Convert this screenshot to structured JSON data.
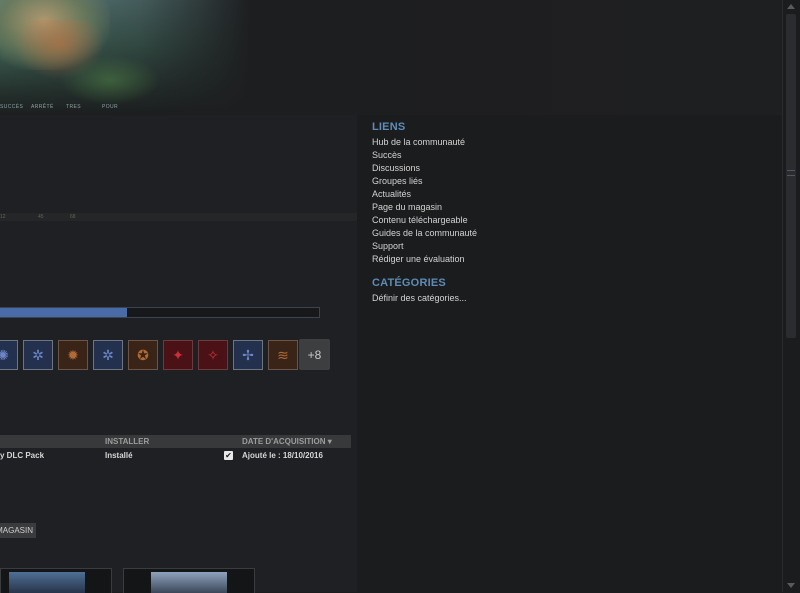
{
  "hero": {
    "tabs": [
      "SUCCÈS",
      "ARRÊTÉ",
      "TRES",
      "POUR"
    ]
  },
  "stats": [
    "12",
    "45",
    "68"
  ],
  "achievements": {
    "progress_fraction": 0.4,
    "more_label": "+8",
    "icons": [
      {
        "name": "achievement-icon-1",
        "style": "blue",
        "glyph": "✺"
      },
      {
        "name": "achievement-icon-2",
        "style": "blue",
        "glyph": "✲"
      },
      {
        "name": "achievement-icon-3",
        "style": "orange",
        "glyph": "✹"
      },
      {
        "name": "achievement-icon-4",
        "style": "blue",
        "glyph": "✲"
      },
      {
        "name": "achievement-icon-5",
        "style": "orange",
        "glyph": "✪"
      },
      {
        "name": "achievement-icon-6",
        "style": "red",
        "glyph": "✦"
      },
      {
        "name": "achievement-icon-7",
        "style": "red",
        "glyph": "✧"
      },
      {
        "name": "achievement-icon-8",
        "style": "blue",
        "glyph": "✢"
      },
      {
        "name": "achievement-icon-9",
        "style": "orange",
        "glyph": "≋"
      }
    ]
  },
  "dlc": {
    "headers": {
      "installer": "INSTALLER",
      "date": "DATE D'ACQUISITION ▾"
    },
    "row": {
      "name": "y DLC Pack",
      "status": "Installé",
      "date": "Ajouté le : 18/10/2016"
    },
    "store_button": "MAGASIN"
  },
  "links": {
    "title": "LIENS",
    "items": [
      "Hub de la communauté",
      "Succès",
      "Discussions",
      "Groupes liés",
      "Actualités",
      "Page du magasin",
      "Contenu téléchargeable",
      "Guides de la communauté",
      "Support",
      "Rédiger une évaluation"
    ]
  },
  "categories": {
    "title": "CATÉGORIES",
    "items": [
      "Définir des catégories..."
    ]
  },
  "colors": {
    "accent": "#5e8cb6",
    "progress": "#4a6aa8"
  }
}
